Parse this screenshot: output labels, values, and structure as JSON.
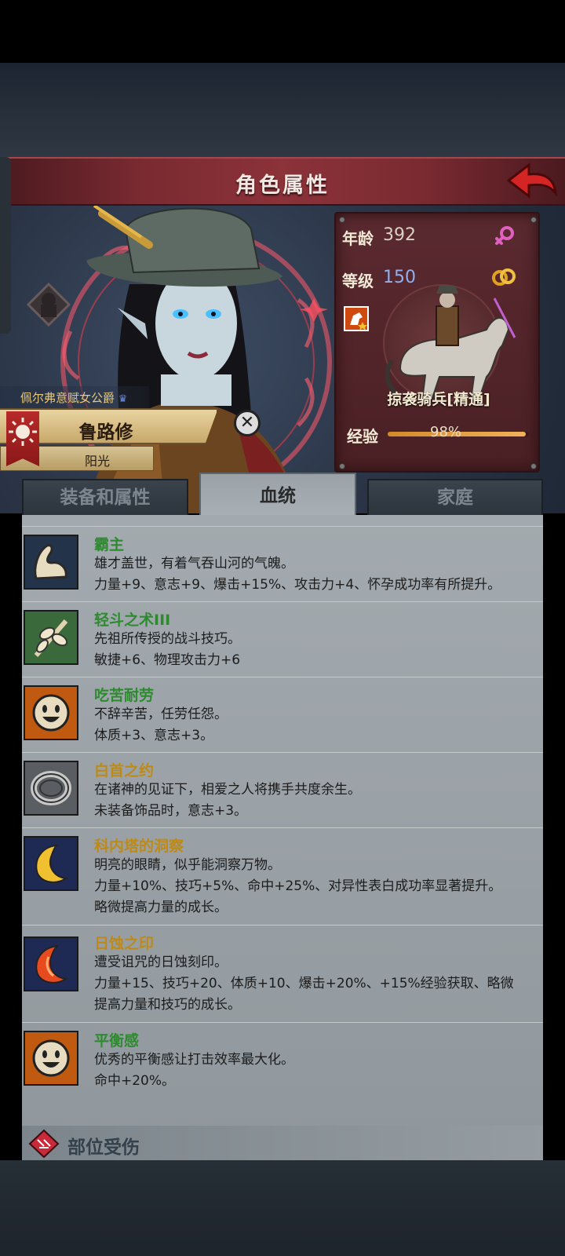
{
  "header": {
    "title": "角色属性"
  },
  "character": {
    "noble_title": "佩尔弗意赋女公爵",
    "name": "鲁路修",
    "trait": "阳光"
  },
  "stats": {
    "age_label": "年龄",
    "age_value": "392",
    "level_label": "等级",
    "level_value": "150",
    "unit_name": "掠袭骑兵[精通]",
    "exp_label": "经验",
    "exp_value": "98%",
    "exp_fraction": 0.98
  },
  "tabs": [
    {
      "label": "装备和属性"
    },
    {
      "label": "血统"
    },
    {
      "label": "家庭"
    }
  ],
  "traits": [
    {
      "name": "霸主",
      "lines": [
        "雄才盖世，有着气吞山河的气魄。",
        "力量+9、意志+9、爆击+15%、攻击力+4、怀孕成功率有所提升。"
      ]
    },
    {
      "name": "轻斗之术III",
      "lines": [
        "先祖所传授的战斗技巧。",
        "敏捷+6、物理攻击力+6"
      ]
    },
    {
      "name": "吃苦耐劳",
      "lines": [
        "不辞辛苦，任劳任怨。",
        "体质+3、意志+3。"
      ]
    },
    {
      "name": "白首之约",
      "lines": [
        "在诸神的见证下，相爱之人将携手共度余生。",
        "未装备饰品时，意志+3。"
      ]
    },
    {
      "name": "科内塔的洞察",
      "lines": [
        "明亮的眼睛，似乎能洞察万物。",
        "力量+10%、技巧+5%、命中+25%、对异性表白成功率显著提升。",
        "略微提高力量的成长。"
      ]
    },
    {
      "name": "日蚀之印",
      "lines": [
        "遭受诅咒的日蚀刻印。",
        "力量+15、技巧+20、体质+10、爆击+20%、+15%经验获取、略微",
        "提高力量和技巧的成长。"
      ]
    },
    {
      "name": "平衡感",
      "lines": [
        "优秀的平衡感让打击效率最大化。",
        "命中+20%。"
      ]
    }
  ],
  "footer": {
    "section_label": "部位受伤"
  }
}
